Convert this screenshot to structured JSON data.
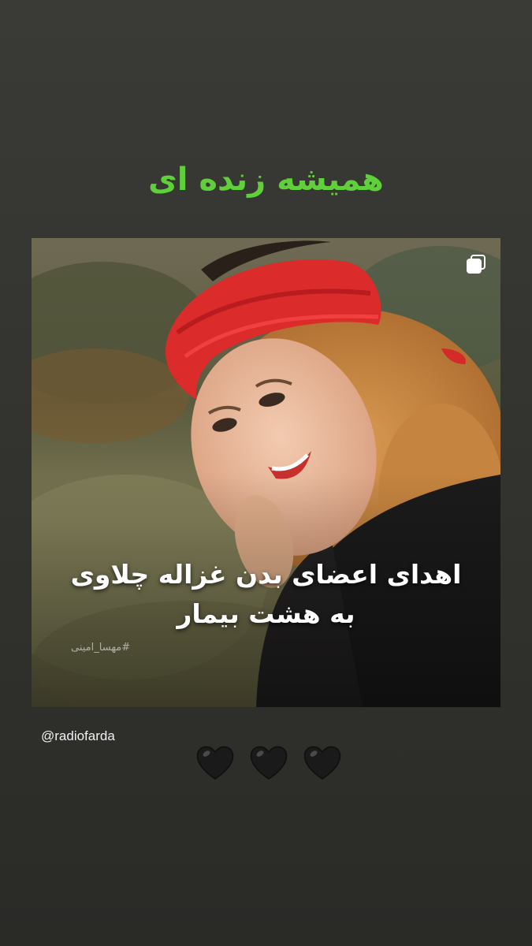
{
  "story": {
    "headline": "همیشه زنده ای",
    "post": {
      "caption_line1": "اهدای اعضای بدن غزاله چلاوی",
      "caption_line2": "به هشت بیمار",
      "credit": "#مهسا_امینی",
      "multi_icon": "carousel-icon"
    },
    "mention": "@radiofarda",
    "hearts": [
      "black-heart",
      "black-heart",
      "black-heart"
    ]
  },
  "colors": {
    "headline": "#5fcf3a",
    "background": "#33332f",
    "heart": "#1a1a1a"
  }
}
